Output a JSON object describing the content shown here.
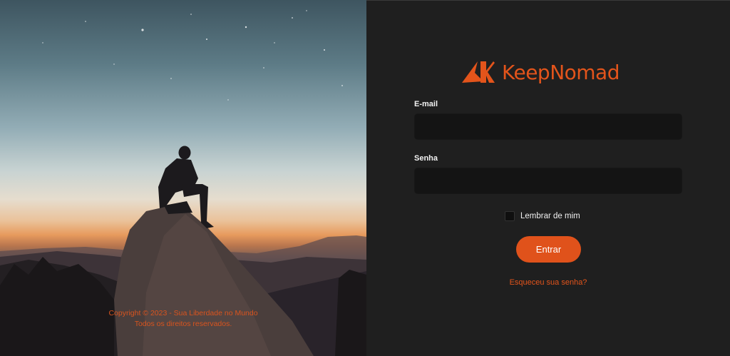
{
  "brand": {
    "name": "KeepNomad",
    "accent": "#e3541b"
  },
  "hero": {
    "alt": "Man sitting on a mountain peak at dusk",
    "copyright_line1": "Copyright © 2023 - Sua Liberdade no Mundo",
    "copyright_line2": "Todos os direitos reservados."
  },
  "form": {
    "email_label": "E-mail",
    "email_value": "",
    "email_placeholder": "",
    "password_label": "Senha",
    "password_value": "",
    "password_placeholder": "",
    "remember_label": "Lembrar de mim",
    "remember_checked": false,
    "submit_label": "Entrar",
    "forgot_label": "Esqueceu sua senha?"
  },
  "icons": {
    "logo": "keepnomad-logo-icon",
    "checkbox": "checkbox-icon"
  }
}
